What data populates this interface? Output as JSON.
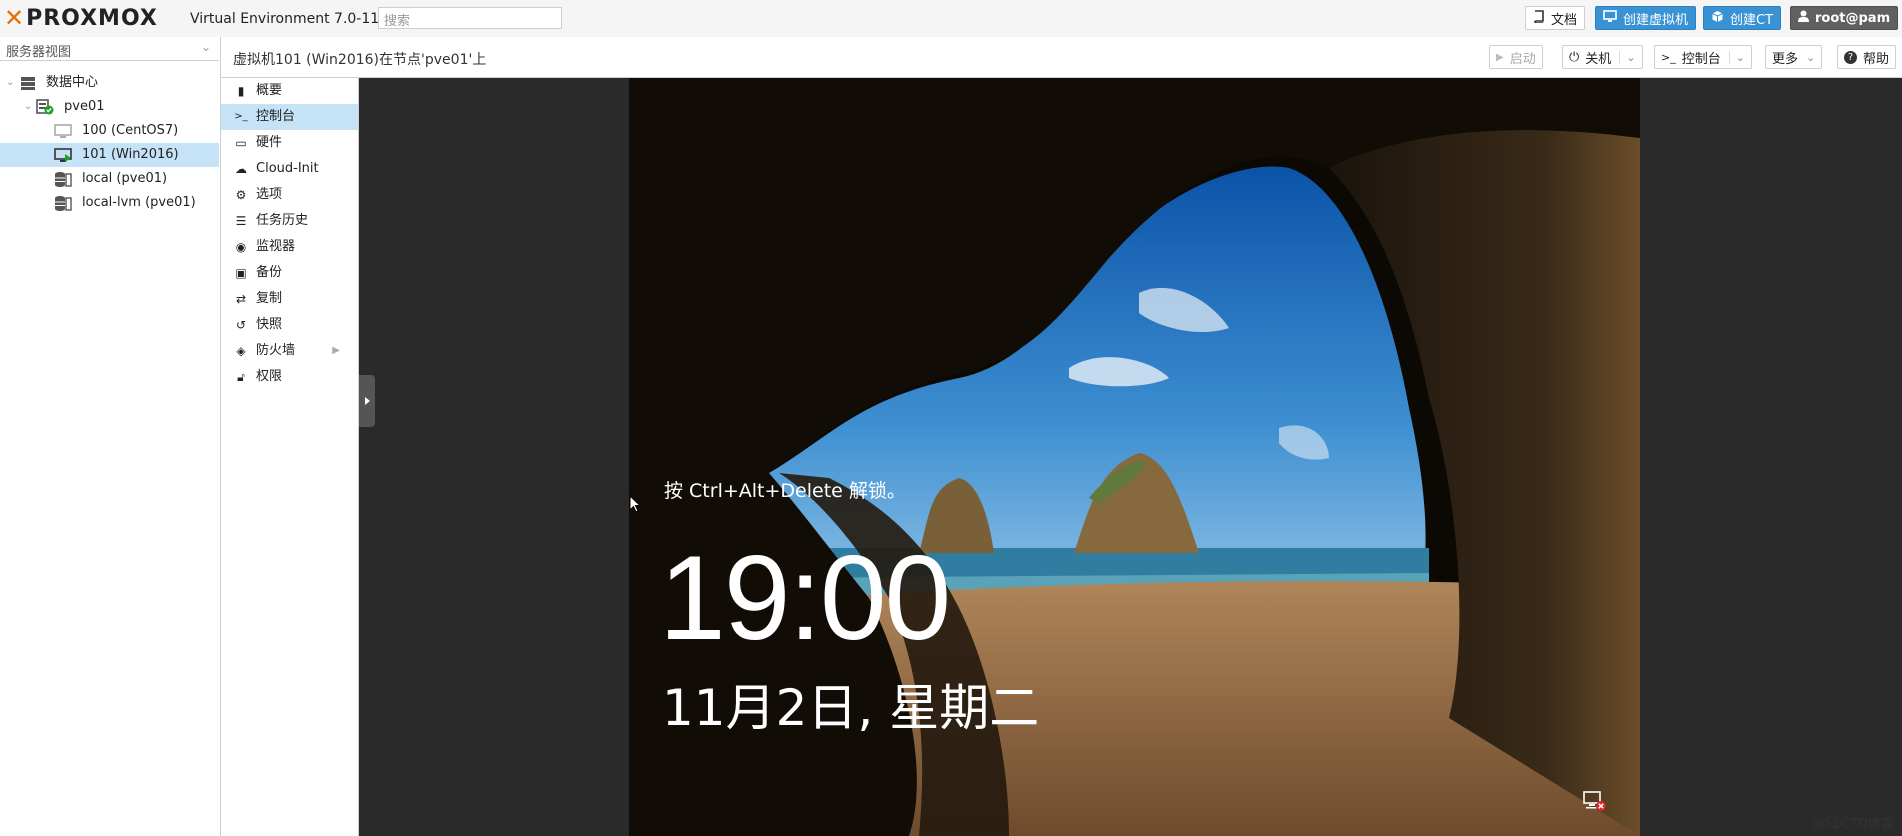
{
  "header": {
    "logo_text": "PROXMOX",
    "version": "Virtual Environment 7.0-11",
    "search_placeholder": "搜索",
    "docs_label": "文档",
    "create_vm_label": "创建虚拟机",
    "create_ct_label": "创建CT",
    "user_label": "root@pam"
  },
  "sidebar": {
    "view_select": "服务器视图",
    "tree": [
      {
        "label": "数据中心",
        "icon": "datacenter-icon"
      },
      {
        "label": "pve01",
        "icon": "node-online-icon"
      },
      {
        "label": "100 (CentOS7)",
        "icon": "vm-stopped-icon"
      },
      {
        "label": "101 (Win2016)",
        "icon": "vm-running-icon",
        "selected": true
      },
      {
        "label": "local (pve01)",
        "icon": "storage-icon"
      },
      {
        "label": "local-lvm (pve01)",
        "icon": "storage-icon"
      }
    ]
  },
  "main": {
    "title": "虚拟机101 (Win2016)在节点'pve01'上",
    "actions": {
      "start": "启动",
      "shutdown": "关机",
      "console": "控制台",
      "more": "更多",
      "help": "帮助"
    },
    "menu": [
      {
        "label": "概要",
        "icon": "book-icon"
      },
      {
        "label": "控制台",
        "icon": "terminal-icon",
        "selected": true
      },
      {
        "label": "硬件",
        "icon": "monitor-icon"
      },
      {
        "label": "Cloud-Init",
        "icon": "cloud-icon"
      },
      {
        "label": "选项",
        "icon": "gear-icon"
      },
      {
        "label": "任务历史",
        "icon": "list-icon"
      },
      {
        "label": "监视器",
        "icon": "eye-icon"
      },
      {
        "label": "备份",
        "icon": "floppy-icon"
      },
      {
        "label": "复制",
        "icon": "retweet-icon"
      },
      {
        "label": "快照",
        "icon": "history-icon"
      },
      {
        "label": "防火墙",
        "icon": "shield-icon",
        "has_submenu": true
      },
      {
        "label": "权限",
        "icon": "unlock-icon"
      }
    ]
  },
  "console_screen": {
    "prompt": "按 Ctrl+Alt+Delete 解锁。",
    "time": "19:00",
    "date": "11月2日, 星期二"
  },
  "watermark": "@51CTO博客",
  "colors": {
    "accent_orange": "#e57000",
    "primary_blue": "#3892d4",
    "selection": "#c6e2f7",
    "user_button": "#606060"
  }
}
